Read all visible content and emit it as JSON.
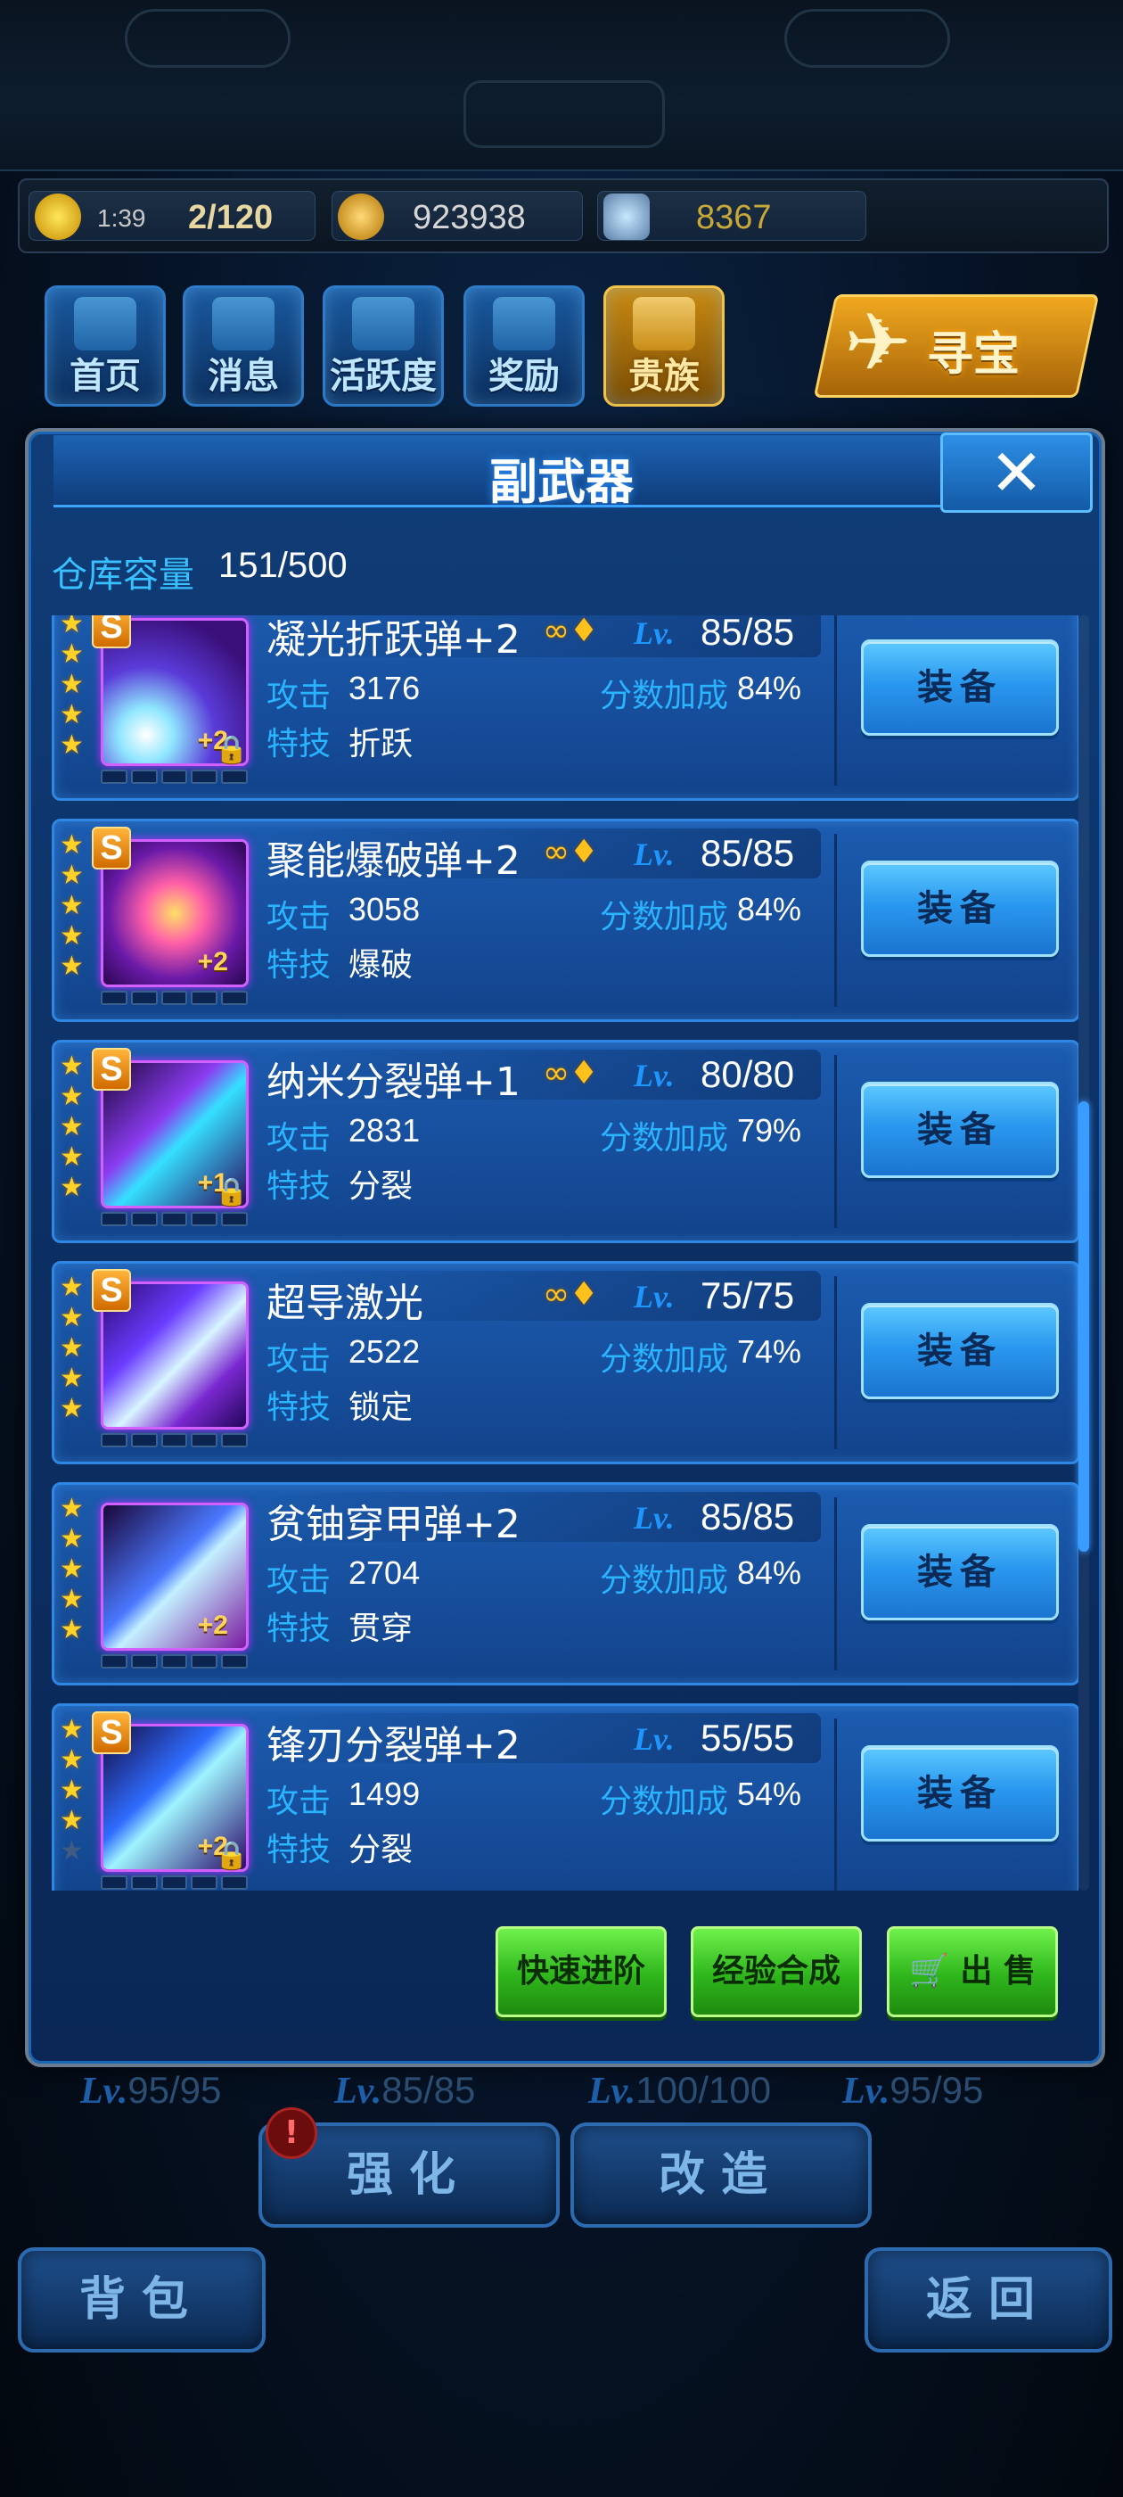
{
  "resources": {
    "timer": "1:39",
    "energy": "2/120",
    "gold": "923938",
    "gems": "8367"
  },
  "menu": [
    {
      "label": "首页",
      "gold": false
    },
    {
      "label": "消息",
      "gold": false
    },
    {
      "label": "活跃度",
      "gold": false
    },
    {
      "label": "奖励",
      "gold": false
    },
    {
      "label": "贵族",
      "gold": true
    }
  ],
  "treasure_label": "寻宝",
  "panel": {
    "title": "副武器",
    "close_glyph": "✕",
    "capacity_label": "仓库容量",
    "capacity_value": "151/500"
  },
  "item_labels": {
    "attack": "攻击",
    "bonus": "分数加成",
    "skill": "特技",
    "lv": "Lv.",
    "equip": "装备"
  },
  "items": [
    {
      "name": "凝光折跃弹+2",
      "grade": "S",
      "stars": 5,
      "lv": "85/85",
      "attack": "3176",
      "bonus": "84%",
      "skill": "折跃",
      "plus": "+2",
      "locked": true,
      "linked": true,
      "art": "fan"
    },
    {
      "name": "聚能爆破弹+2",
      "grade": "S",
      "stars": 5,
      "lv": "85/85",
      "attack": "3058",
      "bonus": "84%",
      "skill": "爆破",
      "plus": "+2",
      "locked": false,
      "linked": true,
      "art": "burst"
    },
    {
      "name": "纳米分裂弹+1",
      "grade": "S",
      "stars": 5,
      "lv": "80/80",
      "attack": "2831",
      "bonus": "79%",
      "skill": "分裂",
      "plus": "+1",
      "locked": true,
      "linked": true,
      "art": "blade"
    },
    {
      "name": "超导激光",
      "grade": "S",
      "stars": 5,
      "lv": "75/75",
      "attack": "2522",
      "bonus": "74%",
      "skill": "锁定",
      "plus": "",
      "locked": false,
      "linked": true,
      "art": "beam"
    },
    {
      "name": "贫铀穿甲弹+2",
      "grade": "",
      "stars": 5,
      "lv": "85/85",
      "attack": "2704",
      "bonus": "84%",
      "skill": "贯穿",
      "plus": "+2",
      "locked": false,
      "linked": false,
      "art": "missile"
    },
    {
      "name": "锋刃分裂弹+2",
      "grade": "S",
      "stars": 4,
      "lv": "55/55",
      "attack": "1499",
      "bonus": "54%",
      "skill": "分裂",
      "plus": "+2",
      "locked": true,
      "linked": false,
      "art": "blade2"
    }
  ],
  "actions": {
    "fast_advance": "快速进阶",
    "exp_merge": "经验合成",
    "sell": "出 售"
  },
  "hud": {
    "levels": [
      "95/95",
      "85/85",
      "100/100",
      "95/95"
    ],
    "lv_prefix": "Lv.",
    "strengthen": "强化",
    "modify": "改造",
    "bag": "背包",
    "back": "返回",
    "alert": "!"
  }
}
